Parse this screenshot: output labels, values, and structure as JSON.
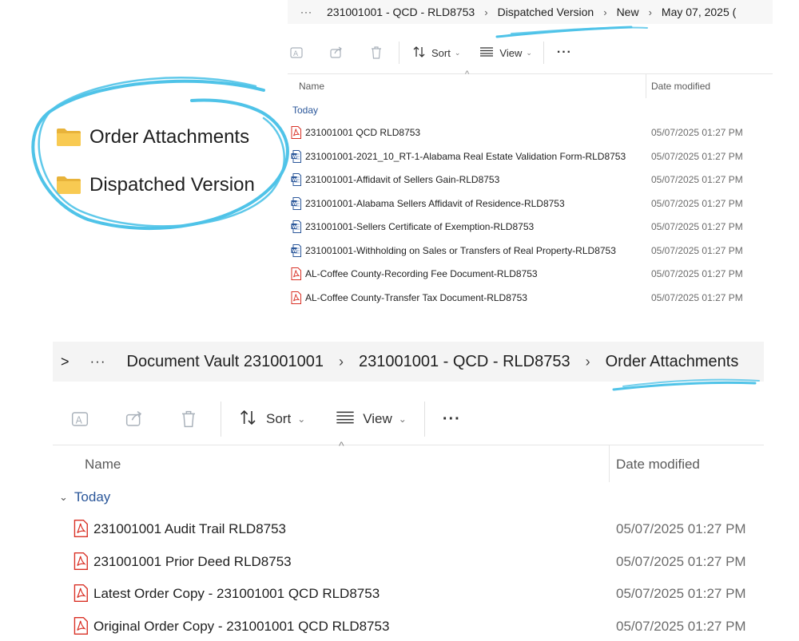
{
  "highlight": {
    "folders": [
      {
        "label": "Order Attachments",
        "icon": "folder-icon"
      },
      {
        "label": "Dispatched Version",
        "icon": "folder-icon"
      }
    ],
    "accent_color": "#4fc3e8",
    "folder_color": "#f5c542"
  },
  "top_explorer": {
    "breadcrumb": {
      "more": "···",
      "items": [
        "231001001 - QCD - RLD8753",
        "Dispatched Version",
        "New",
        "May 07, 2025 ("
      ]
    },
    "toolbar": {
      "sort_label": "Sort",
      "view_label": "View",
      "more_label": "···"
    },
    "columns": {
      "name": "Name",
      "date": "Date modified"
    },
    "group": "Today",
    "files": [
      {
        "name": "231001001 QCD RLD8753",
        "date": "05/07/2025 01:27 PM",
        "type": "pdf"
      },
      {
        "name": "231001001-2021_10_RT-1-Alabama Real Estate Validation Form-RLD8753",
        "date": "05/07/2025 01:27 PM",
        "type": "word"
      },
      {
        "name": "231001001-Affidavit of Sellers Gain-RLD8753",
        "date": "05/07/2025 01:27 PM",
        "type": "word"
      },
      {
        "name": "231001001-Alabama Sellers Affidavit of Residence-RLD8753",
        "date": "05/07/2025 01:27 PM",
        "type": "word"
      },
      {
        "name": "231001001-Sellers Certificate of Exemption-RLD8753",
        "date": "05/07/2025 01:27 PM",
        "type": "word"
      },
      {
        "name": "231001001-Withholding on Sales or Transfers of Real Property-RLD8753",
        "date": "05/07/2025 01:27 PM",
        "type": "word"
      },
      {
        "name": "AL-Coffee County-Recording Fee Document-RLD8753",
        "date": "05/07/2025 01:27 PM",
        "type": "pdf"
      },
      {
        "name": "AL-Coffee County-Transfer Tax Document-RLD8753",
        "date": "05/07/2025 01:27 PM",
        "type": "pdf"
      }
    ]
  },
  "bottom_explorer": {
    "breadcrumb": {
      "chevron": ">",
      "more": "···",
      "items": [
        "Document Vault 231001001",
        "231001001 - QCD - RLD8753",
        "Order Attachments"
      ]
    },
    "toolbar": {
      "sort_label": "Sort",
      "view_label": "View",
      "more_label": "···"
    },
    "columns": {
      "name": "Name",
      "date": "Date modified"
    },
    "group": "Today",
    "files": [
      {
        "name": "231001001 Audit Trail RLD8753",
        "date": "05/07/2025 01:27 PM",
        "type": "pdf"
      },
      {
        "name": "231001001 Prior Deed RLD8753",
        "date": "05/07/2025 01:27 PM",
        "type": "pdf"
      },
      {
        "name": "Latest Order Copy - 231001001 QCD RLD8753",
        "date": "05/07/2025 01:27 PM",
        "type": "pdf"
      },
      {
        "name": "Original Order Copy - 231001001 QCD RLD8753",
        "date": "05/07/2025 01:27 PM",
        "type": "pdf"
      }
    ]
  }
}
